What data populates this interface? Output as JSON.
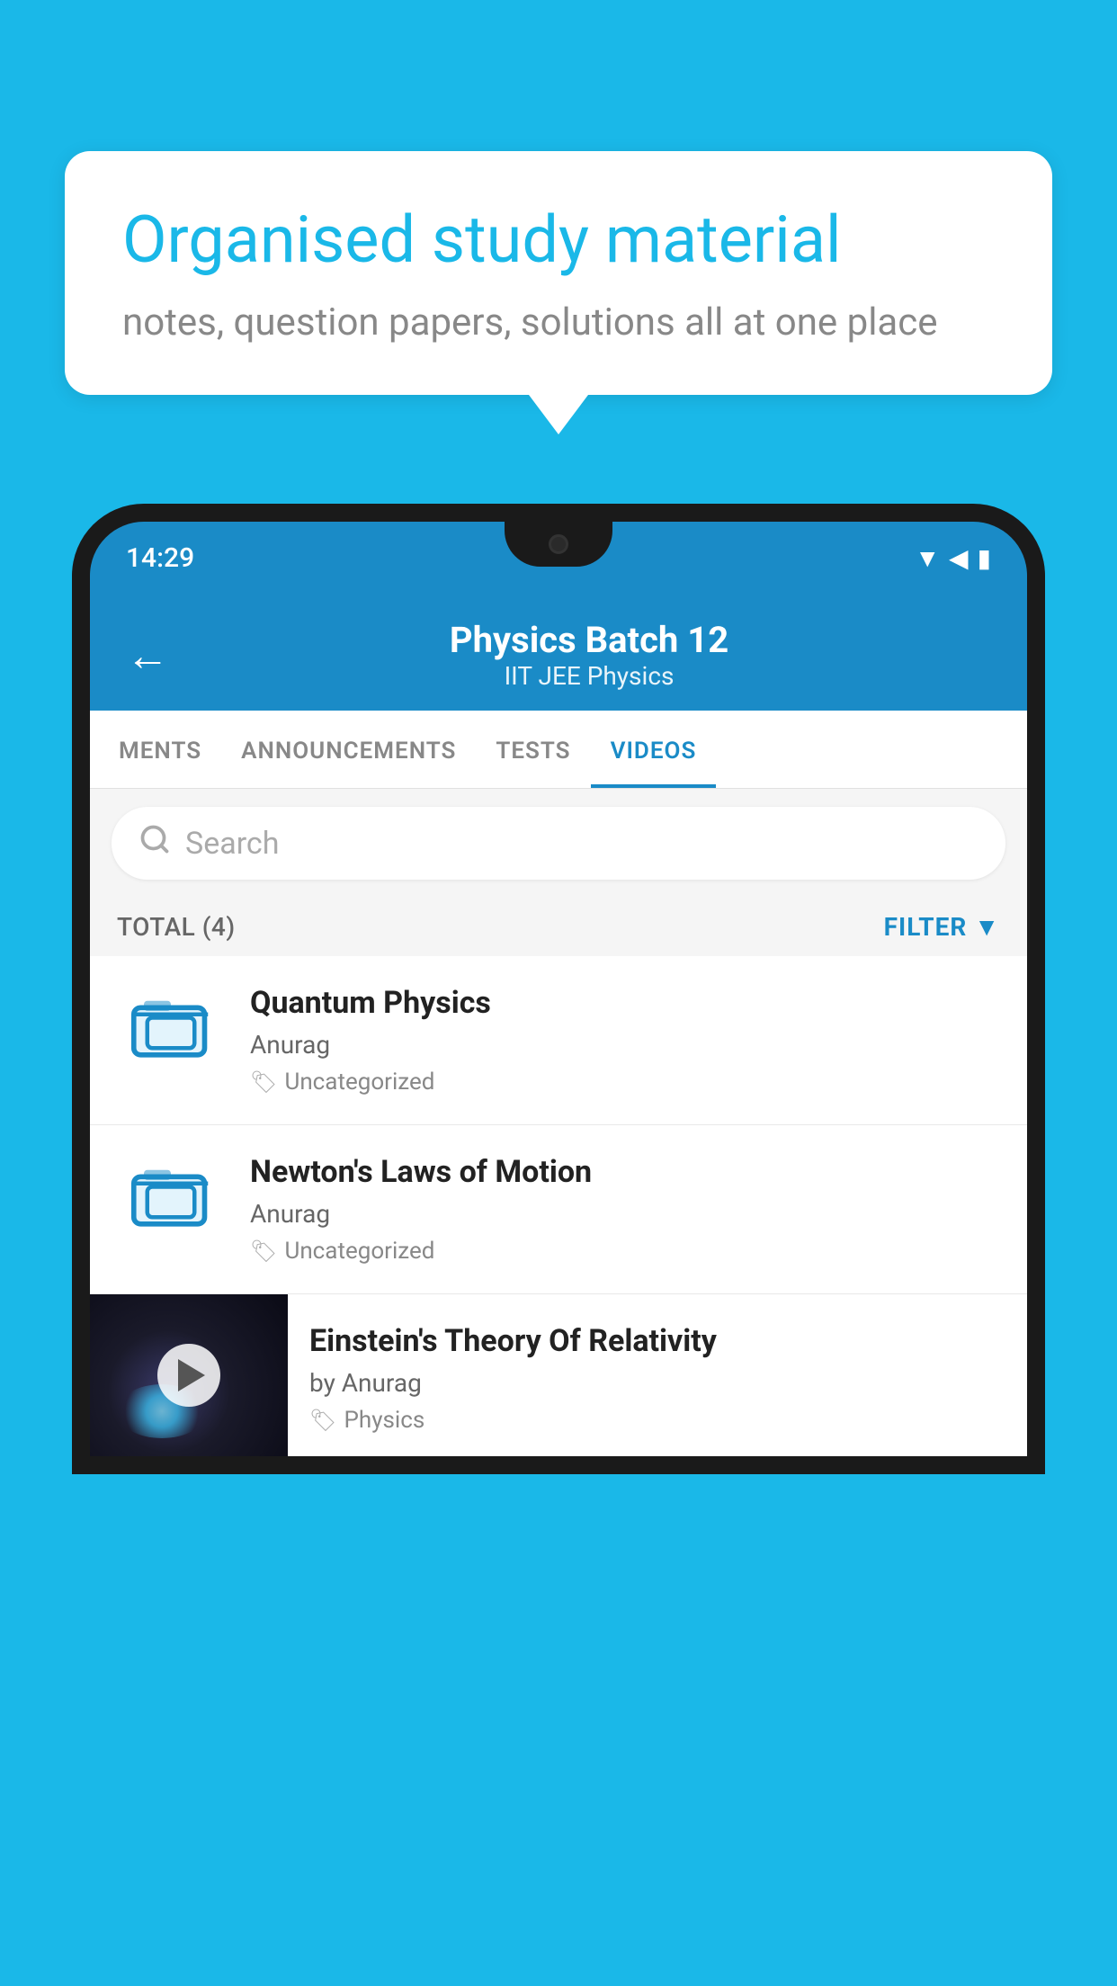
{
  "background_color": "#1ab8e8",
  "bubble": {
    "title": "Organised study material",
    "subtitle": "notes, question papers, solutions all at one place"
  },
  "phone": {
    "time": "14:29",
    "header": {
      "title": "Physics Batch 12",
      "subtitle": "IIT JEE   Physics",
      "back_label": "←"
    },
    "tabs": [
      {
        "label": "MENTS",
        "active": false
      },
      {
        "label": "ANNOUNCEMENTS",
        "active": false
      },
      {
        "label": "TESTS",
        "active": false
      },
      {
        "label": "VIDEOS",
        "active": true
      }
    ],
    "search": {
      "placeholder": "Search"
    },
    "filter": {
      "total_label": "TOTAL (4)",
      "button_label": "FILTER"
    },
    "videos": [
      {
        "id": "1",
        "title": "Quantum Physics",
        "author": "Anurag",
        "tag": "Uncategorized",
        "type": "folder"
      },
      {
        "id": "2",
        "title": "Newton's Laws of Motion",
        "author": "Anurag",
        "tag": "Uncategorized",
        "type": "folder"
      },
      {
        "id": "3",
        "title": "Einstein's Theory Of Relativity",
        "author": "by Anurag",
        "tag": "Physics",
        "type": "video"
      }
    ]
  }
}
